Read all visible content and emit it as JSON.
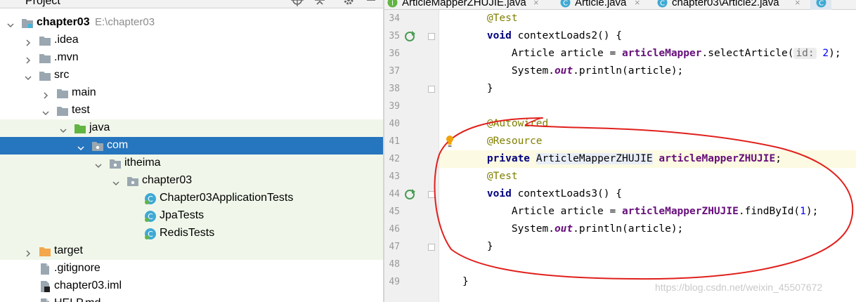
{
  "project_panel": {
    "title": "Project",
    "tree": [
      {
        "label": "chapter03",
        "path": "E:\\chapter03",
        "icon": "module-folder-icon",
        "chevron": "down",
        "depth": 0,
        "bold": true,
        "state": ""
      },
      {
        "label": ".idea",
        "icon": "folder-icon",
        "chevron": "right",
        "depth": 1,
        "state": ""
      },
      {
        "label": ".mvn",
        "icon": "folder-icon",
        "chevron": "right",
        "depth": 1,
        "state": ""
      },
      {
        "label": "src",
        "icon": "folder-icon",
        "chevron": "down",
        "depth": 1,
        "state": ""
      },
      {
        "label": "main",
        "icon": "folder-icon",
        "chevron": "right",
        "depth": 2,
        "state": ""
      },
      {
        "label": "test",
        "icon": "folder-icon",
        "chevron": "down",
        "depth": 2,
        "state": ""
      },
      {
        "label": "java",
        "icon": "test-source-folder-icon",
        "chevron": "down",
        "depth": 3,
        "state": "highlighted"
      },
      {
        "label": "com",
        "icon": "package-icon",
        "chevron": "down",
        "depth": 4,
        "state": "selected"
      },
      {
        "label": "itheima",
        "icon": "package-icon",
        "chevron": "down",
        "depth": 5,
        "state": "highlighted"
      },
      {
        "label": "chapter03",
        "icon": "package-icon",
        "chevron": "down",
        "depth": 6,
        "state": "highlighted"
      },
      {
        "label": "Chapter03ApplicationTests",
        "icon": "class-icon",
        "chevron": "",
        "depth": 7,
        "state": "highlighted"
      },
      {
        "label": "JpaTests",
        "icon": "class-icon",
        "chevron": "",
        "depth": 7,
        "state": "highlighted"
      },
      {
        "label": "RedisTests",
        "icon": "class-icon",
        "chevron": "",
        "depth": 7,
        "state": "highlighted"
      },
      {
        "label": "target",
        "icon": "excluded-folder-icon",
        "chevron": "right",
        "depth": 1,
        "state": "highlighted"
      },
      {
        "label": ".gitignore",
        "icon": "file-icon",
        "chevron": "",
        "depth": 1,
        "state": ""
      },
      {
        "label": "chapter03.iml",
        "icon": "iml-file-icon",
        "chevron": "",
        "depth": 1,
        "state": ""
      },
      {
        "label": "HELP.md",
        "icon": "file-icon",
        "chevron": "",
        "depth": 1,
        "state": ""
      }
    ]
  },
  "editor": {
    "tabs": [
      {
        "label": "ArticleMapperZHUJIE.java",
        "icon": "interface-icon"
      },
      {
        "label": "Article.java",
        "icon": "class-icon"
      },
      {
        "label": "chapter03\\Article2.java",
        "icon": "class-icon"
      }
    ],
    "lines": [
      {
        "n": "34",
        "tokens": [
          {
            "t": "    "
          },
          {
            "t": "@Test",
            "c": "ann"
          }
        ]
      },
      {
        "n": "35",
        "run": true,
        "fold": true,
        "tokens": [
          {
            "t": "    "
          },
          {
            "t": "void",
            "c": "kw"
          },
          {
            "t": " contextLoads2() {"
          }
        ]
      },
      {
        "n": "36",
        "tokens": [
          {
            "t": "        Article article = "
          },
          {
            "t": "articleMapper",
            "c": "fld"
          },
          {
            "t": ".selectArticle("
          },
          {
            "t": "id:",
            "c": "hint"
          },
          {
            "t": " "
          },
          {
            "t": "2",
            "c": "num"
          },
          {
            "t": ");"
          }
        ]
      },
      {
        "n": "37",
        "tokens": [
          {
            "t": "        System."
          },
          {
            "t": "out",
            "c": "ital"
          },
          {
            "t": ".println(article);"
          }
        ]
      },
      {
        "n": "38",
        "fold": true,
        "tokens": [
          {
            "t": "    }"
          }
        ]
      },
      {
        "n": "39",
        "tokens": []
      },
      {
        "n": "40",
        "tokens": [
          {
            "t": "    "
          },
          {
            "t": "@Autowired",
            "c": "ann"
          }
        ]
      },
      {
        "n": "41",
        "bulb": true,
        "tokens": [
          {
            "t": "    "
          },
          {
            "t": "@Resource",
            "c": "ann"
          }
        ]
      },
      {
        "n": "42",
        "current": true,
        "tokens": [
          {
            "t": "    "
          },
          {
            "t": "private",
            "c": "kw"
          },
          {
            "t": " "
          },
          {
            "t": "ArticleMapperZHUJIE",
            "c": "typebox"
          },
          {
            "t": " "
          },
          {
            "t": "articleMapperZHUJIE",
            "c": "fld"
          },
          {
            "t": ";"
          }
        ]
      },
      {
        "n": "43",
        "tokens": [
          {
            "t": "    "
          },
          {
            "t": "@Test",
            "c": "ann"
          }
        ]
      },
      {
        "n": "44",
        "run": true,
        "fold": true,
        "tokens": [
          {
            "t": "    "
          },
          {
            "t": "void",
            "c": "kw"
          },
          {
            "t": " contextLoads3() {"
          }
        ]
      },
      {
        "n": "45",
        "tokens": [
          {
            "t": "        Article article = "
          },
          {
            "t": "articleMapperZHUJIE",
            "c": "fld"
          },
          {
            "t": ".findById("
          },
          {
            "t": "1",
            "c": "num"
          },
          {
            "t": ");"
          }
        ]
      },
      {
        "n": "46",
        "tokens": [
          {
            "t": "        System."
          },
          {
            "t": "out",
            "c": "ital"
          },
          {
            "t": ".println(article);"
          }
        ]
      },
      {
        "n": "47",
        "fold": true,
        "tokens": [
          {
            "t": "    }"
          }
        ]
      },
      {
        "n": "48",
        "tokens": []
      },
      {
        "n": "49",
        "tokens": [
          {
            "t": "}"
          }
        ]
      }
    ],
    "watermark": "https://blog.csdn.net/weixin_45507672"
  },
  "colors": {
    "selection": "#2675bf",
    "test_highlight": "#f0f7ea",
    "annotation_ink": "#e0201c",
    "keyword": "#000080",
    "field": "#660e7a",
    "annotation": "#808000"
  }
}
